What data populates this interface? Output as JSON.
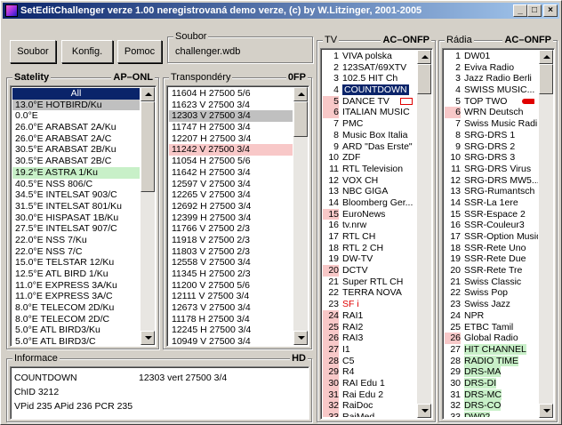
{
  "window": {
    "title": "SetEditChallenger verze  1.00  neregistrovaná demo verze, (c) by W.Litzinger, 2001-2005",
    "min": "_",
    "max": "□",
    "close": "×"
  },
  "toolbar": {
    "soubor": "Soubor",
    "konfig": "Konfig.",
    "pomoc": "Pomoc"
  },
  "file": {
    "label": "Soubor",
    "value": "challenger.wdb"
  },
  "satellites": {
    "label": "Satelity",
    "flags": "AP–ONL",
    "items": [
      "All",
      "13.0°E  HOTBIRD/Ku",
      "0.0°E",
      "26.0°E  ARABSAT 2A/Ku",
      "26.0°E  ARABSAT 2A/C",
      "30.5°E  ARABSAT 2B/Ku",
      "30.5°E  ARABSAT 2B/C",
      "19.2°E  ASTRA 1/Ku",
      "40.5°E  NSS 806/C",
      "34.5°E  INTELSAT 903/C",
      "31.5°E  INTELSAT 801/Ku",
      "30.0°E  HISPASAT 1B/Ku",
      "27.5°E  INTELSAT 907/C",
      "22.0°E  NSS 7/Ku",
      "22.0°E  NSS 7/C",
      "15.0°E  TELSTAR 12/Ku",
      "12.5°E  ATL BIRD 1/Ku",
      "11.0°E  EXPRESS 3A/Ku",
      "11.0°E  EXPRESS 3A/C",
      "8.0°E  TELECOM 2D/Ku",
      "8.0°E  TELECOM 2D/C",
      "5.0°E  ATL BIRD3/Ku",
      "5.0°E  ATL BIRD3/C"
    ],
    "bg": [
      "#0a246a",
      "#c0c0c0",
      "",
      "",
      "",
      "",
      "",
      "#c8f0c8",
      "",
      "",
      "",
      "",
      "",
      "",
      "",
      "",
      "",
      "",
      "",
      "",
      "",
      "",
      ""
    ]
  },
  "transponders": {
    "label": "Transpondéry",
    "flags": "0FP",
    "items": [
      "11604  H  27500   5/6",
      "11623  V  27500   3/4",
      "12303  V  27500   3/4",
      "11747  H  27500   3/4",
      "12207  H  27500   3/4",
      "11242  V  27500   3/4",
      "11054  H  27500   5/6",
      "11642  H  27500   3/4",
      "12597  V  27500   3/4",
      "12265  V  27500   3/4",
      "12692  H  27500   3/4",
      "12399  H  27500   3/4",
      "11766  V  27500   2/3",
      "11918  V  27500   2/3",
      "11803  V  27500   2/3",
      "12558  V  27500   3/4",
      "11345  H  27500   2/3",
      "11200  V  27500   5/6",
      "12111  V  27500   3/4",
      "12673  V  27500   3/4",
      "11178  H  27500   3/4",
      "12245  H  27500   3/4",
      "10949  V  27500   3/4"
    ],
    "bg": [
      "",
      "",
      "#c0c0c0",
      "",
      "",
      "#f8c8c8",
      "",
      "",
      "",
      "",
      "",
      "",
      "",
      "",
      "",
      "",
      "",
      "",
      "",
      "",
      "",
      "",
      ""
    ]
  },
  "tv": {
    "label": "TV",
    "flags": "AC–ONFP",
    "items": [
      [
        "1",
        "VIVA polska"
      ],
      [
        "2",
        "123SAT/69XTV"
      ],
      [
        "3",
        "102.5 HIT Ch"
      ],
      [
        "4",
        "COUNTDOWN"
      ],
      [
        "5",
        "DANCE TV"
      ],
      [
        "6",
        "ITALIAN MUSIC"
      ],
      [
        "7",
        "PMC"
      ],
      [
        "8",
        "Music Box Italia"
      ],
      [
        "9",
        "ARD \"Das Erste\""
      ],
      [
        "10",
        "ZDF"
      ],
      [
        "11",
        "RTL Television"
      ],
      [
        "12",
        "VOX CH"
      ],
      [
        "13",
        "NBC GIGA"
      ],
      [
        "14",
        "Bloomberg Ger..."
      ],
      [
        "15",
        "EuroNews"
      ],
      [
        "16",
        "tv.nrw"
      ],
      [
        "17",
        "RTL CH"
      ],
      [
        "18",
        "RTL 2 CH"
      ],
      [
        "19",
        "DW-TV"
      ],
      [
        "20",
        "DCTV"
      ],
      [
        "21",
        "Super RTL CH"
      ],
      [
        "22",
        "TERRA NOVA"
      ],
      [
        "23",
        "SF i"
      ],
      [
        "24",
        "RAI1"
      ],
      [
        "25",
        "RAI2"
      ],
      [
        "26",
        "RAI3"
      ],
      [
        "27",
        "I1"
      ],
      [
        "28",
        "C5"
      ],
      [
        "29",
        "R4"
      ],
      [
        "30",
        "RAI Edu 1"
      ],
      [
        "31",
        "Rai Edu 2"
      ],
      [
        "32",
        "RaiDoc"
      ],
      [
        "33",
        "RaiMed"
      ]
    ],
    "bg": [
      "",
      "",
      "",
      "#0a246a",
      "#f8c8c8",
      "#f8c8c8",
      "",
      "",
      "",
      "",
      "",
      "",
      "",
      "",
      "#f8c8c8",
      "",
      "",
      "",
      "",
      "#f8c8c8",
      "",
      "",
      "",
      "#f8c8c8",
      "#f8c8c8",
      "#f8c8c8",
      "#f8c8c8",
      "#f8c8c8",
      "#f8c8c8",
      "#f8c8c8",
      "#f8c8c8",
      "#f8c8c8",
      "#f8c8c8"
    ]
  },
  "radio": {
    "label": "Rádia",
    "flags": "AC–ONFP",
    "items": [
      [
        "1",
        "DW01"
      ],
      [
        "2",
        "Eviva Radio"
      ],
      [
        "3",
        "Jazz Radio Berli"
      ],
      [
        "4",
        "SWISS MUSIC..."
      ],
      [
        "5",
        "TOP TWO"
      ],
      [
        "6",
        "WRN Deutsch"
      ],
      [
        "7",
        "Swiss Music Radi"
      ],
      [
        "8",
        "SRG-DRS 1"
      ],
      [
        "9",
        "SRG-DRS 2"
      ],
      [
        "10",
        "SRG-DRS 3"
      ],
      [
        "11",
        "SRG-DRS Virus"
      ],
      [
        "12",
        "SRG-DRS MW5..."
      ],
      [
        "13",
        "SRG-Rumantsch"
      ],
      [
        "14",
        "SSR-La 1ere"
      ],
      [
        "15",
        "SSR-Espace 2"
      ],
      [
        "16",
        "SSR-Couleur3"
      ],
      [
        "17",
        "SSR-Option Musiq"
      ],
      [
        "18",
        "SSR-Rete Uno"
      ],
      [
        "19",
        "SSR-Rete Due"
      ],
      [
        "20",
        "SSR-Rete Tre"
      ],
      [
        "21",
        "Swiss Classic"
      ],
      [
        "22",
        "Swiss Pop"
      ],
      [
        "23",
        "Swiss Jazz"
      ],
      [
        "24",
        "NPR"
      ],
      [
        "25",
        "ETBC Tamil"
      ],
      [
        "26",
        "Global Radio"
      ],
      [
        "27",
        "HIT CHANNEL"
      ],
      [
        "28",
        "RADIO TIME"
      ],
      [
        "29",
        "DRS-MA"
      ],
      [
        "30",
        "DRS-DI"
      ],
      [
        "31",
        "DRS-MC"
      ],
      [
        "32",
        "DRS-CO"
      ],
      [
        "33",
        "DW02"
      ]
    ],
    "bg": [
      "",
      "",
      "",
      "",
      "",
      "#f8c8c8",
      "",
      "",
      "",
      "",
      "",
      "",
      "",
      "",
      "",
      "",
      "",
      "",
      "",
      "",
      "",
      "",
      "",
      "",
      "",
      "#f8c8c8",
      "#c8f0c8",
      "#c8f0c8",
      "#c8f0c8",
      "#c8f0c8",
      "#c8f0c8",
      "#c8f0c8",
      "#c8f0c8"
    ]
  },
  "info": {
    "label": "Informace",
    "flag": "HD",
    "line1a": "COUNTDOWN",
    "line1b": "12303 vert 27500 3/4",
    "line2": "ChID 3212",
    "line3": "VPid 235    APid 236    PCR 235"
  },
  "colors": {
    "selected": "#0a246a",
    "pink": "#f8c8c8",
    "green": "#c8f0c8",
    "red": "#e00000"
  }
}
